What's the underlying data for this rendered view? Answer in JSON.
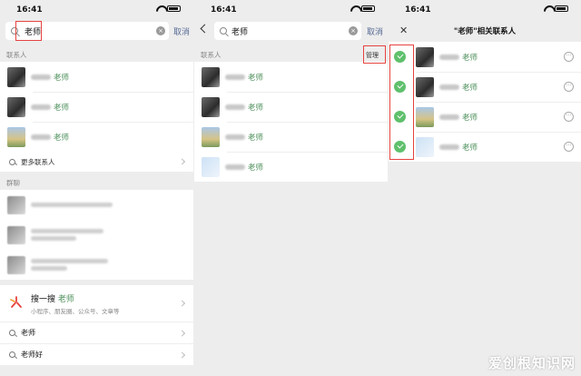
{
  "status": {
    "time": "16:41"
  },
  "search": {
    "query": "老师",
    "cancel_label": "取消"
  },
  "panel1": {
    "contacts_header": "联系人",
    "contacts": [
      {
        "avatar": "dark",
        "name_match": "老师"
      },
      {
        "avatar": "dark",
        "name_match": "老师"
      },
      {
        "avatar": "land",
        "name_match": "老师"
      }
    ],
    "more_contacts_label": "更多联系人",
    "groups_header": "群聊",
    "sousou": {
      "title": "搜一搜",
      "highlight": "老师",
      "subtitle": "小程序、朋友圈、公众号、文章等"
    },
    "suggestions": [
      "老师",
      "老师好"
    ]
  },
  "panel2": {
    "contacts_header": "联系人",
    "manage_label": "管理",
    "contacts": [
      {
        "avatar": "dark",
        "name_match": "老师"
      },
      {
        "avatar": "dark",
        "name_match": "老师"
      },
      {
        "avatar": "land",
        "name_match": "老师"
      },
      {
        "avatar": "light",
        "name_match": "老师"
      }
    ]
  },
  "panel3": {
    "title": "\"老师\"相关联系人",
    "more_glyph": "···",
    "contacts": [
      {
        "avatar": "dark",
        "name_match": "老师"
      },
      {
        "avatar": "dark",
        "name_match": "老师"
      },
      {
        "avatar": "land",
        "name_match": "老师"
      },
      {
        "avatar": "light",
        "name_match": "老师"
      }
    ]
  },
  "watermark": "爱创根知识网",
  "colors": {
    "highlight_box": "#e64340",
    "check_green": "#5fc06c",
    "match_text": "#4c8f5a"
  }
}
